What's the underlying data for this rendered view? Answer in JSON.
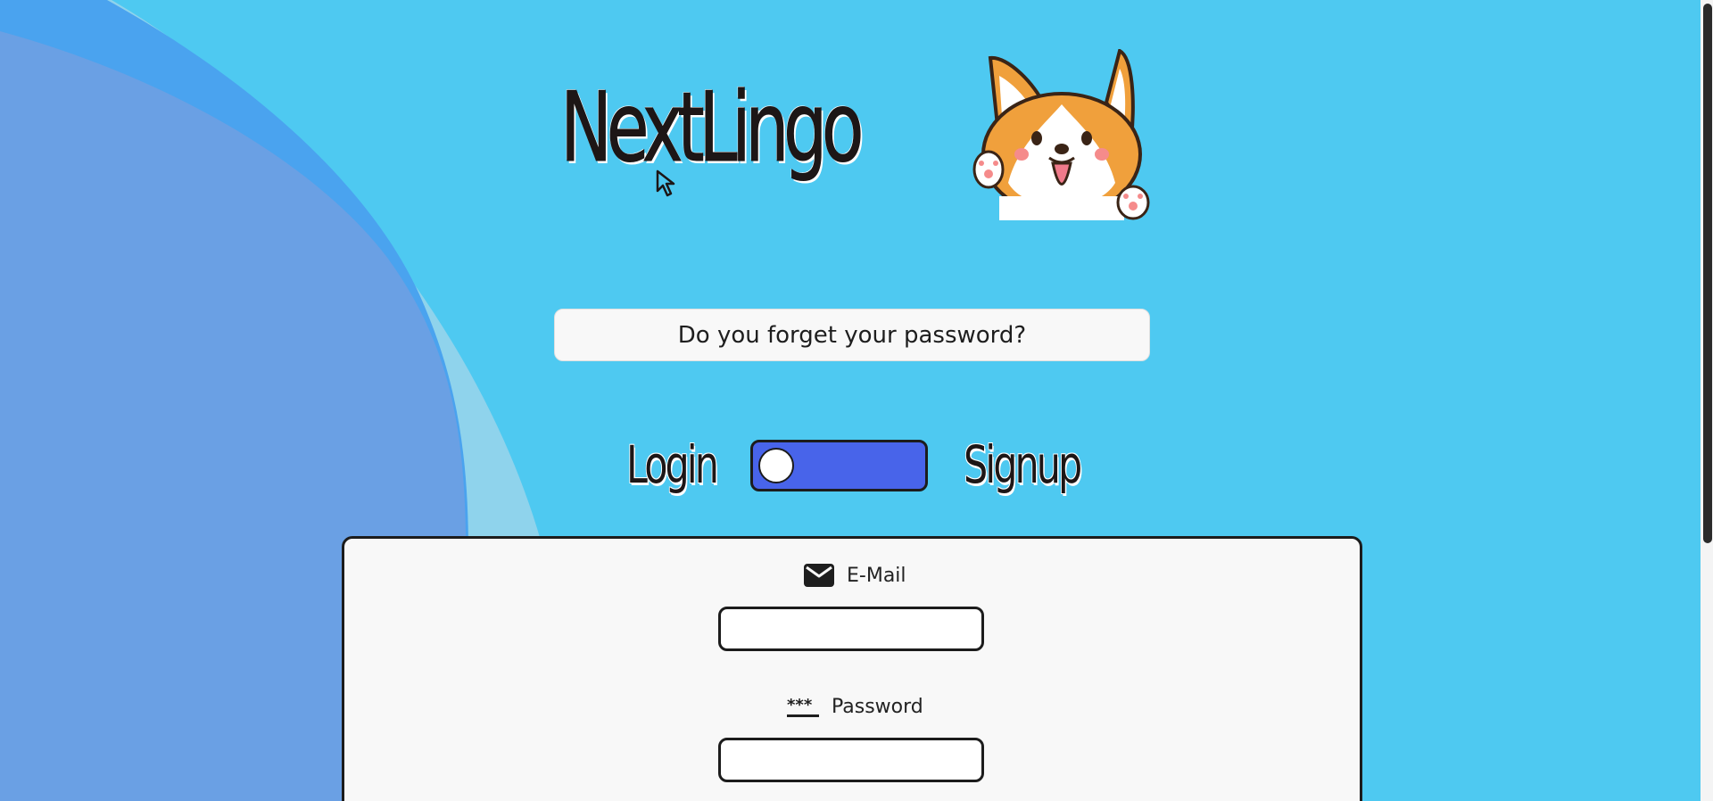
{
  "app": {
    "title": "NextLingo",
    "mascot_icon": "corgi-mascot-icon",
    "background_color": "#4ec9f1",
    "accent_color": "#4864ea"
  },
  "forgot": {
    "label": "Do you forget your password?"
  },
  "mode": {
    "login_label": "Login",
    "signup_label": "Signup",
    "toggle_state": "login"
  },
  "form": {
    "email": {
      "label": "E-Mail",
      "icon": "envelope-icon",
      "value": "",
      "placeholder": ""
    },
    "password": {
      "label": "Password",
      "icon": "asterisk-icon",
      "value": "",
      "placeholder": ""
    }
  }
}
